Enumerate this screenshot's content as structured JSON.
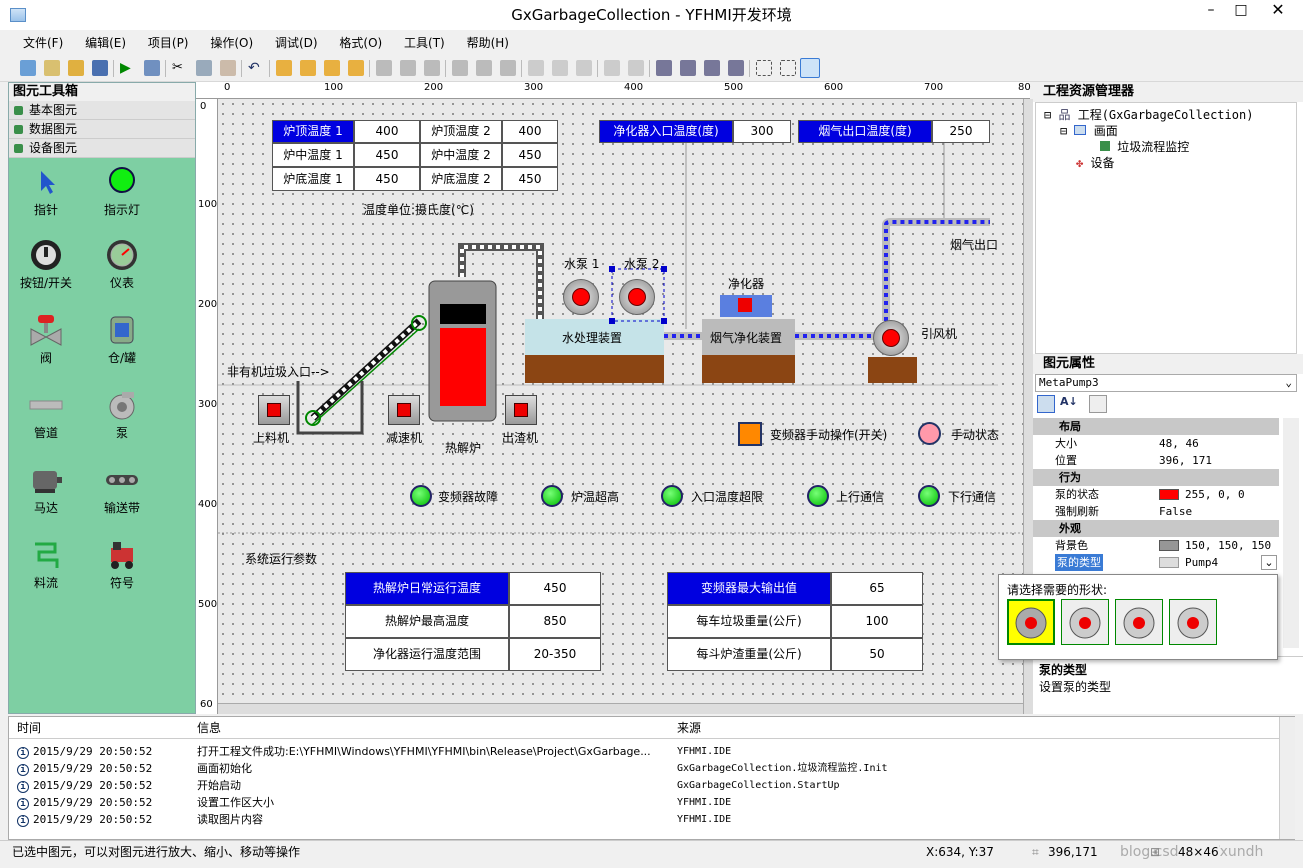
{
  "window": {
    "title": "GxGarbageCollection - YFHMI开发环境"
  },
  "menu": [
    "文件(F)",
    "编辑(E)",
    "项目(P)",
    "操作(O)",
    "调试(D)",
    "格式(O)",
    "工具(T)",
    "帮助(H)"
  ],
  "toolbox": {
    "title": "图元工具箱",
    "categories": [
      "基本图元",
      "数据图元",
      "设备图元"
    ],
    "tools": [
      "指针",
      "指示灯",
      "按钮/开关",
      "仪表",
      "阀",
      "仓/罐",
      "管道",
      "泵",
      "马达",
      "输送带",
      "料流",
      "符号"
    ]
  },
  "ruler": {
    "top": [
      "0",
      "100",
      "200",
      "300",
      "400",
      "500",
      "600",
      "700",
      "80"
    ],
    "left": [
      "0",
      "100",
      "200",
      "300",
      "400",
      "500",
      "60"
    ]
  },
  "canvas": {
    "temps": {
      "top1": {
        "label": "炉顶温度 1",
        "value": "400"
      },
      "top2": {
        "label": "炉顶温度 2",
        "value": "400"
      },
      "mid1": {
        "label": "炉中温度 1",
        "value": "450"
      },
      "mid2": {
        "label": "炉中温度 2",
        "value": "450"
      },
      "bot1": {
        "label": "炉底温度 1",
        "value": "450"
      },
      "bot2": {
        "label": "炉底温度 2",
        "value": "450"
      },
      "unit": "温度单位:摄氏度(℃)"
    },
    "purifier_in": {
      "label": "净化器入口温度(度)",
      "value": "300"
    },
    "flue_out": {
      "label": "烟气出口温度(度)",
      "value": "250"
    },
    "labels": {
      "pump1": "水泵 1",
      "pump2": "水泵 2",
      "purifier": "净化器",
      "water": "水处理装置",
      "flue": "烟气净化装置",
      "fan": "引风机",
      "flue_exit": "烟气出口",
      "entry": "非有机垃圾入口-->",
      "loader": "上料机",
      "reducer": "减速机",
      "furnace": "热解炉",
      "discharger": "出渣机",
      "vfd_manual": "变频器手动操作(开关)",
      "manual_state": "手动状态",
      "section": "系统运行参数"
    },
    "alarms": [
      "变频器故障",
      "炉温超高",
      "入口温度超限",
      "上行通信",
      "下行通信"
    ],
    "params_left": [
      {
        "label": "热解炉日常运行温度",
        "value": "450"
      },
      {
        "label": "热解炉最高温度",
        "value": "850"
      },
      {
        "label": "净化器运行温度范围",
        "value": "20-350"
      }
    ],
    "params_right": [
      {
        "label": "变频器最大输出值",
        "value": "65"
      },
      {
        "label": "每车垃圾重量(公斤)",
        "value": "100"
      },
      {
        "label": "每斗炉渣重量(公斤)",
        "value": "50"
      }
    ]
  },
  "explorer": {
    "title": "工程资源管理器",
    "project": "工程(GxGarbageCollection)",
    "screen": "画面",
    "page": "垃圾流程监控",
    "device": "设备"
  },
  "props": {
    "title": "图元属性",
    "object": "MetaPump3",
    "cat_layout": "布局",
    "size_k": "大小",
    "size_v": "48, 46",
    "pos_k": "位置",
    "pos_v": "396, 171",
    "cat_behavior": "行为",
    "state_k": "泵的状态",
    "state_v": "255, 0, 0",
    "refresh_k": "强制刷新",
    "refresh_v": "False",
    "cat_look": "外观",
    "bg_k": "背景色",
    "bg_v": "150, 150, 150",
    "type_k": "泵的类型",
    "type_v": "Pump4",
    "popup_title": "请选择需要的形状:",
    "desc_title": "泵的类型",
    "desc": "设置泵的类型",
    "state_color": "#ff0000",
    "bg_color": "#969696"
  },
  "log": {
    "headers": [
      "时间",
      "信息",
      "来源"
    ],
    "rows": [
      [
        "2015/9/29 20:50:52",
        "打开工程文件成功:E:\\YFHMI\\Windows\\YFHMI\\YFHMI\\bin\\Release\\Project\\GxGarbage...",
        "YFHMI.IDE"
      ],
      [
        "2015/9/29 20:50:52",
        "画面初始化",
        "GxGarbageCollection.垃圾流程监控.Init"
      ],
      [
        "2015/9/29 20:50:52",
        "开始启动",
        "GxGarbageCollection.StartUp"
      ],
      [
        "2015/9/29 20:50:52",
        "设置工作区大小",
        "YFHMI.IDE"
      ],
      [
        "2015/9/29 20:50:52",
        "读取图片内容",
        "YFHMI.IDE"
      ]
    ]
  },
  "status": {
    "hint": "已选中图元，可以对图元进行放大、缩小、移动等操作",
    "coord": "X:634, Y:37",
    "pos": "396,171",
    "size": "48×46",
    "watermark": "blog.csdn.net/xundh"
  }
}
